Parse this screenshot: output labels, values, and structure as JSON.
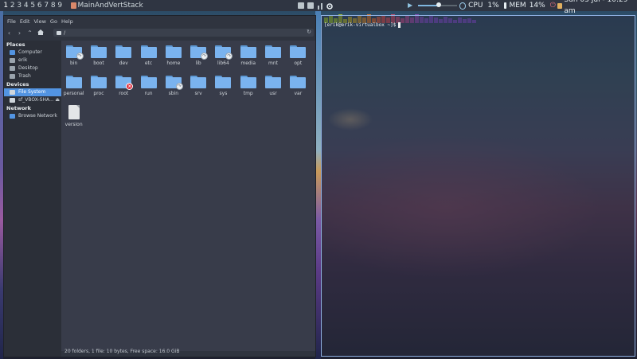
{
  "topbar": {
    "workspaces": [
      "1",
      "2",
      "3",
      "4",
      "5",
      "6",
      "7",
      "8",
      "9"
    ],
    "window_title": "MainAndVertStack",
    "cpu_label": "CPU",
    "cpu_value": "1%",
    "mem_label": "MEM",
    "mem_value": "14%",
    "volume_level": 0.55,
    "datetime": "Sun 03 Jul - 10:29 am"
  },
  "file_manager": {
    "menu": [
      "File",
      "Edit",
      "View",
      "Go",
      "Help"
    ],
    "path": "/",
    "places_header": "Places",
    "places": [
      {
        "label": "Computer",
        "icon": "computer-icon",
        "color": "#5294e2"
      },
      {
        "label": "erik",
        "icon": "home-icon",
        "color": "#9aa4ad"
      },
      {
        "label": "Desktop",
        "icon": "desktop-icon",
        "color": "#9aa4ad"
      },
      {
        "label": "Trash",
        "icon": "trash-icon",
        "color": "#9aa4ad"
      }
    ],
    "devices_header": "Devices",
    "devices": [
      {
        "label": "File System",
        "icon": "drive-icon",
        "color": "#cfd6dc",
        "selected": true
      },
      {
        "label": "sf_VBOX-SHA...",
        "icon": "shared-folder-icon",
        "color": "#cfd6dc",
        "selected": false
      }
    ],
    "network_header": "Network",
    "network": [
      {
        "label": "Browse Network",
        "icon": "network-icon",
        "color": "#5294e2"
      }
    ],
    "items": [
      {
        "name": "bin",
        "kind": "folder",
        "badge": "link"
      },
      {
        "name": "boot",
        "kind": "folder",
        "badge": ""
      },
      {
        "name": "dev",
        "kind": "folder",
        "badge": ""
      },
      {
        "name": "etc",
        "kind": "folder",
        "badge": ""
      },
      {
        "name": "home",
        "kind": "folder",
        "badge": ""
      },
      {
        "name": "lib",
        "kind": "folder",
        "badge": "link"
      },
      {
        "name": "lib64",
        "kind": "folder",
        "badge": "link"
      },
      {
        "name": "media",
        "kind": "folder",
        "badge": ""
      },
      {
        "name": "mnt",
        "kind": "folder",
        "badge": ""
      },
      {
        "name": "opt",
        "kind": "folder",
        "badge": ""
      },
      {
        "name": "personal",
        "kind": "folder",
        "badge": ""
      },
      {
        "name": "proc",
        "kind": "folder",
        "badge": ""
      },
      {
        "name": "root",
        "kind": "folder",
        "badge": "locked"
      },
      {
        "name": "run",
        "kind": "folder",
        "badge": ""
      },
      {
        "name": "sbin",
        "kind": "folder",
        "badge": "link"
      },
      {
        "name": "srv",
        "kind": "folder",
        "badge": ""
      },
      {
        "name": "sys",
        "kind": "folder",
        "badge": ""
      },
      {
        "name": "tmp",
        "kind": "folder",
        "badge": ""
      },
      {
        "name": "usr",
        "kind": "folder",
        "badge": ""
      },
      {
        "name": "var",
        "kind": "folder",
        "badge": ""
      },
      {
        "name": "version",
        "kind": "file",
        "badge": ""
      }
    ],
    "status": "20 folders, 1 file: 10 bytes, Free space: 16.0 GiB"
  },
  "terminal": {
    "prompt": "[erik@erik-virtualbox ~]$"
  },
  "cpu_histogram": [
    {
      "h": 0.6,
      "c": "#9acd32"
    },
    {
      "h": 0.8,
      "c": "#9acd32"
    },
    {
      "h": 0.5,
      "c": "#9acd32"
    },
    {
      "h": 0.9,
      "c": "#a8c832"
    },
    {
      "h": 0.4,
      "c": "#b4c030"
    },
    {
      "h": 0.7,
      "c": "#c0b830"
    },
    {
      "h": 0.5,
      "c": "#c8b030"
    },
    {
      "h": 0.8,
      "c": "#d0a030"
    },
    {
      "h": 0.6,
      "c": "#d89030"
    },
    {
      "h": 0.9,
      "c": "#e08030"
    },
    {
      "h": 0.5,
      "c": "#e07030"
    },
    {
      "h": 0.7,
      "c": "#e06040"
    },
    {
      "h": 0.8,
      "c": "#e05050"
    },
    {
      "h": 0.6,
      "c": "#d85060"
    },
    {
      "h": 0.9,
      "c": "#d05070"
    },
    {
      "h": 0.7,
      "c": "#c85080"
    },
    {
      "h": 0.5,
      "c": "#c05090"
    },
    {
      "h": 0.8,
      "c": "#b050a0"
    },
    {
      "h": 0.6,
      "c": "#a050b0"
    },
    {
      "h": 0.9,
      "c": "#9050c0"
    },
    {
      "h": 0.7,
      "c": "#8050c8"
    },
    {
      "h": 0.5,
      "c": "#7a50d0"
    },
    {
      "h": 0.8,
      "c": "#7a50d0"
    },
    {
      "h": 0.6,
      "c": "#7a50d0"
    },
    {
      "h": 0.4,
      "c": "#7a50d0"
    },
    {
      "h": 0.7,
      "c": "#7a50d0"
    },
    {
      "h": 0.5,
      "c": "#7a50d0"
    },
    {
      "h": 0.3,
      "c": "#7a50d0"
    },
    {
      "h": 0.6,
      "c": "#7a50d0"
    },
    {
      "h": 0.4,
      "c": "#7a50d0"
    },
    {
      "h": 0.5,
      "c": "#7a50d0"
    },
    {
      "h": 0.3,
      "c": "#7a50d0"
    }
  ]
}
